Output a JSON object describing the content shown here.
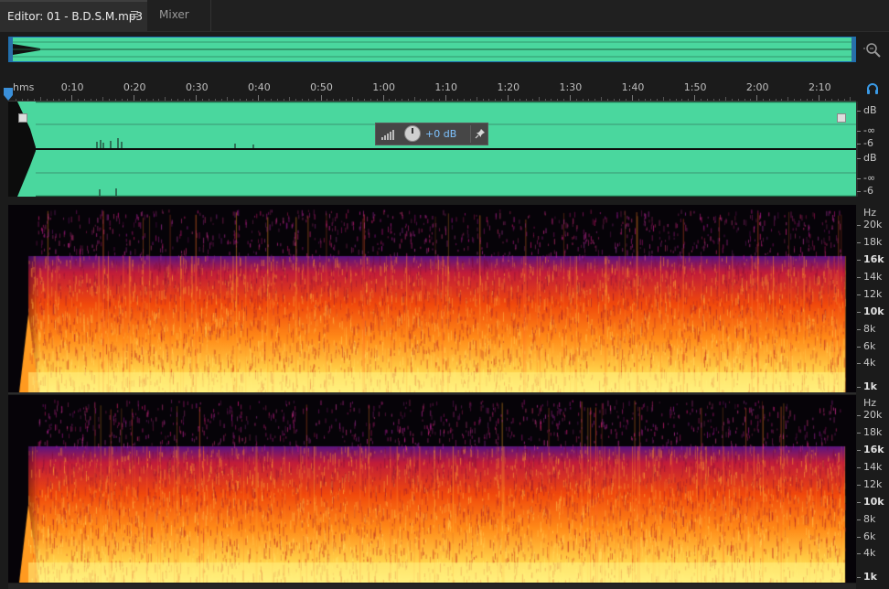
{
  "tabs": {
    "editor_label": "Editor: 01 - B.D.S.M.mp3",
    "mixer_label": "Mixer"
  },
  "ruler": {
    "unit": "hms",
    "ticks": [
      "0:10",
      "0:20",
      "0:30",
      "0:40",
      "0:50",
      "1:00",
      "1:10",
      "1:20",
      "1:30",
      "1:40",
      "1:50",
      "2:00",
      "2:10"
    ]
  },
  "hud": {
    "volume_value": "+0 dB"
  },
  "amplitude_scale": {
    "channel_1": [
      "dB",
      "-∞",
      "-6"
    ],
    "channel_2": [
      "dB",
      "-∞",
      "-6"
    ]
  },
  "frequency_scale": {
    "unit": "Hz",
    "labels": [
      "20k",
      "18k",
      "16k",
      "14k",
      "12k",
      "10k",
      "8k",
      "6k",
      "4k",
      "1k"
    ],
    "bold_labels": [
      "16k",
      "10k",
      "1k"
    ]
  },
  "icons": {
    "tab_menu": "hamburger-icon",
    "zoom": "zoom-navigator-icon",
    "headphones": "headphones-icon",
    "hud_level": "level-meter-icon",
    "hud_pin": "pin-icon",
    "playhead": "playhead-marker-icon"
  },
  "colors": {
    "waveform": "#4ad79e",
    "selection_border": "#1b6fb0",
    "hud_value": "#7ec3ff",
    "spectro_low": "#ffe870",
    "spectro_mid": "#ff6a10",
    "spectro_high": "#3a1270"
  }
}
